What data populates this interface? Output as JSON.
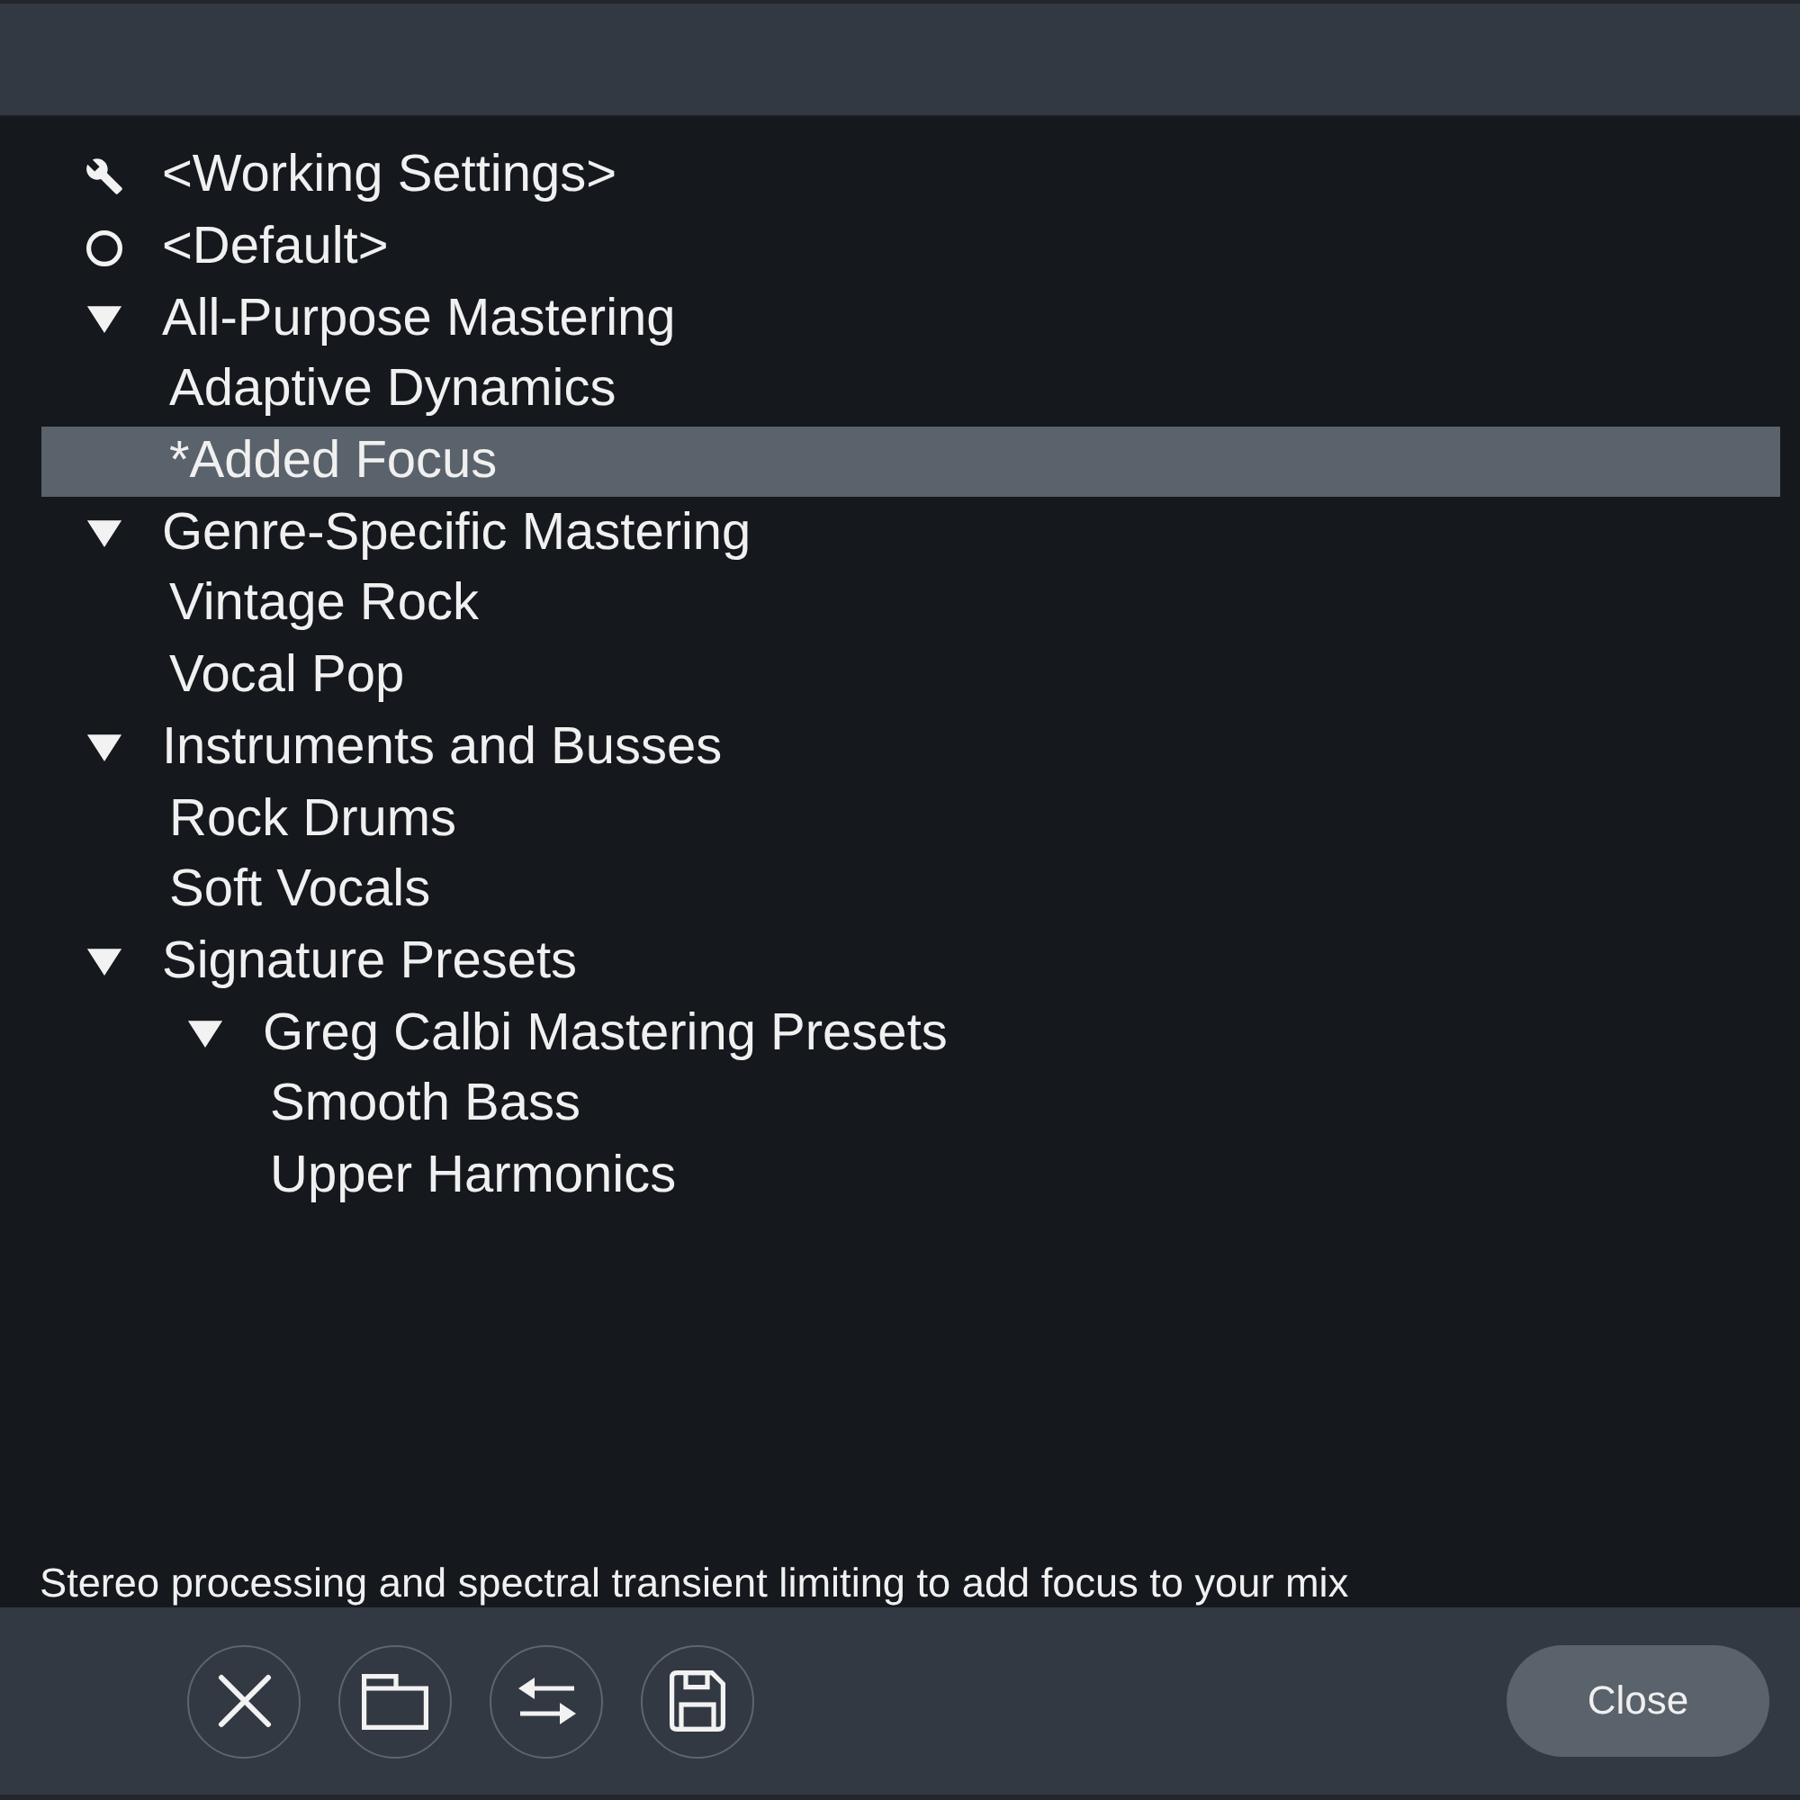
{
  "tree": {
    "items": [
      {
        "kind": "working",
        "label": "<Working Settings>",
        "selected": false
      },
      {
        "kind": "default",
        "label": "<Default>",
        "selected": false
      },
      {
        "kind": "group",
        "label": "All-Purpose Mastering",
        "selected": false,
        "expanded": true,
        "children": [
          {
            "kind": "preset",
            "label": "Adaptive Dynamics",
            "selected": false
          },
          {
            "kind": "preset",
            "label": "*Added Focus",
            "selected": true
          }
        ]
      },
      {
        "kind": "group",
        "label": "Genre-Specific Mastering",
        "selected": false,
        "expanded": true,
        "children": [
          {
            "kind": "preset",
            "label": "Vintage Rock",
            "selected": false
          },
          {
            "kind": "preset",
            "label": "Vocal Pop",
            "selected": false
          }
        ]
      },
      {
        "kind": "group",
        "label": "Instruments and Busses",
        "selected": false,
        "expanded": true,
        "children": [
          {
            "kind": "preset",
            "label": "Rock Drums",
            "selected": false
          },
          {
            "kind": "preset",
            "label": "Soft Vocals",
            "selected": false
          }
        ]
      },
      {
        "kind": "group",
        "label": "Signature Presets",
        "selected": false,
        "expanded": true,
        "children": [
          {
            "kind": "group",
            "label": "Greg Calbi Mastering Presets",
            "selected": false,
            "expanded": true,
            "children": [
              {
                "kind": "preset",
                "label": "Smooth Bass",
                "selected": false
              },
              {
                "kind": "preset",
                "label": "Upper Harmonics",
                "selected": false
              }
            ]
          }
        ]
      }
    ]
  },
  "description": "Stereo processing and spectral transient limiting to add focus to your mix",
  "footer": {
    "icon_buttons": [
      {
        "kind": "delete"
      },
      {
        "kind": "open"
      },
      {
        "kind": "swap"
      },
      {
        "kind": "save"
      }
    ],
    "close_button": "Close"
  }
}
